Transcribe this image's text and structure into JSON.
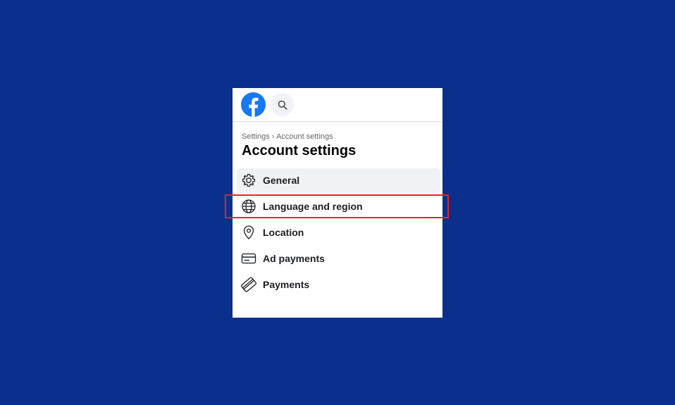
{
  "header": {
    "logo_icon": "facebook-logo-icon",
    "search_icon": "search-icon"
  },
  "breadcrumb": {
    "root": "Settings",
    "separator": "›",
    "current": "Account settings"
  },
  "page_title": "Account settings",
  "menu": [
    {
      "label": "General",
      "icon": "gear-icon",
      "active": true
    },
    {
      "label": "Language and region",
      "icon": "globe-icon",
      "highlighted": true
    },
    {
      "label": "Location",
      "icon": "location-pin-icon"
    },
    {
      "label": "Ad payments",
      "icon": "card-icon"
    },
    {
      "label": "Payments",
      "icon": "payment-card-icon"
    }
  ],
  "colors": {
    "background": "#0a2f8c",
    "facebook_blue": "#1877f2",
    "highlight_red": "#e0262a",
    "active_item_bg": "#f0f2f5"
  }
}
